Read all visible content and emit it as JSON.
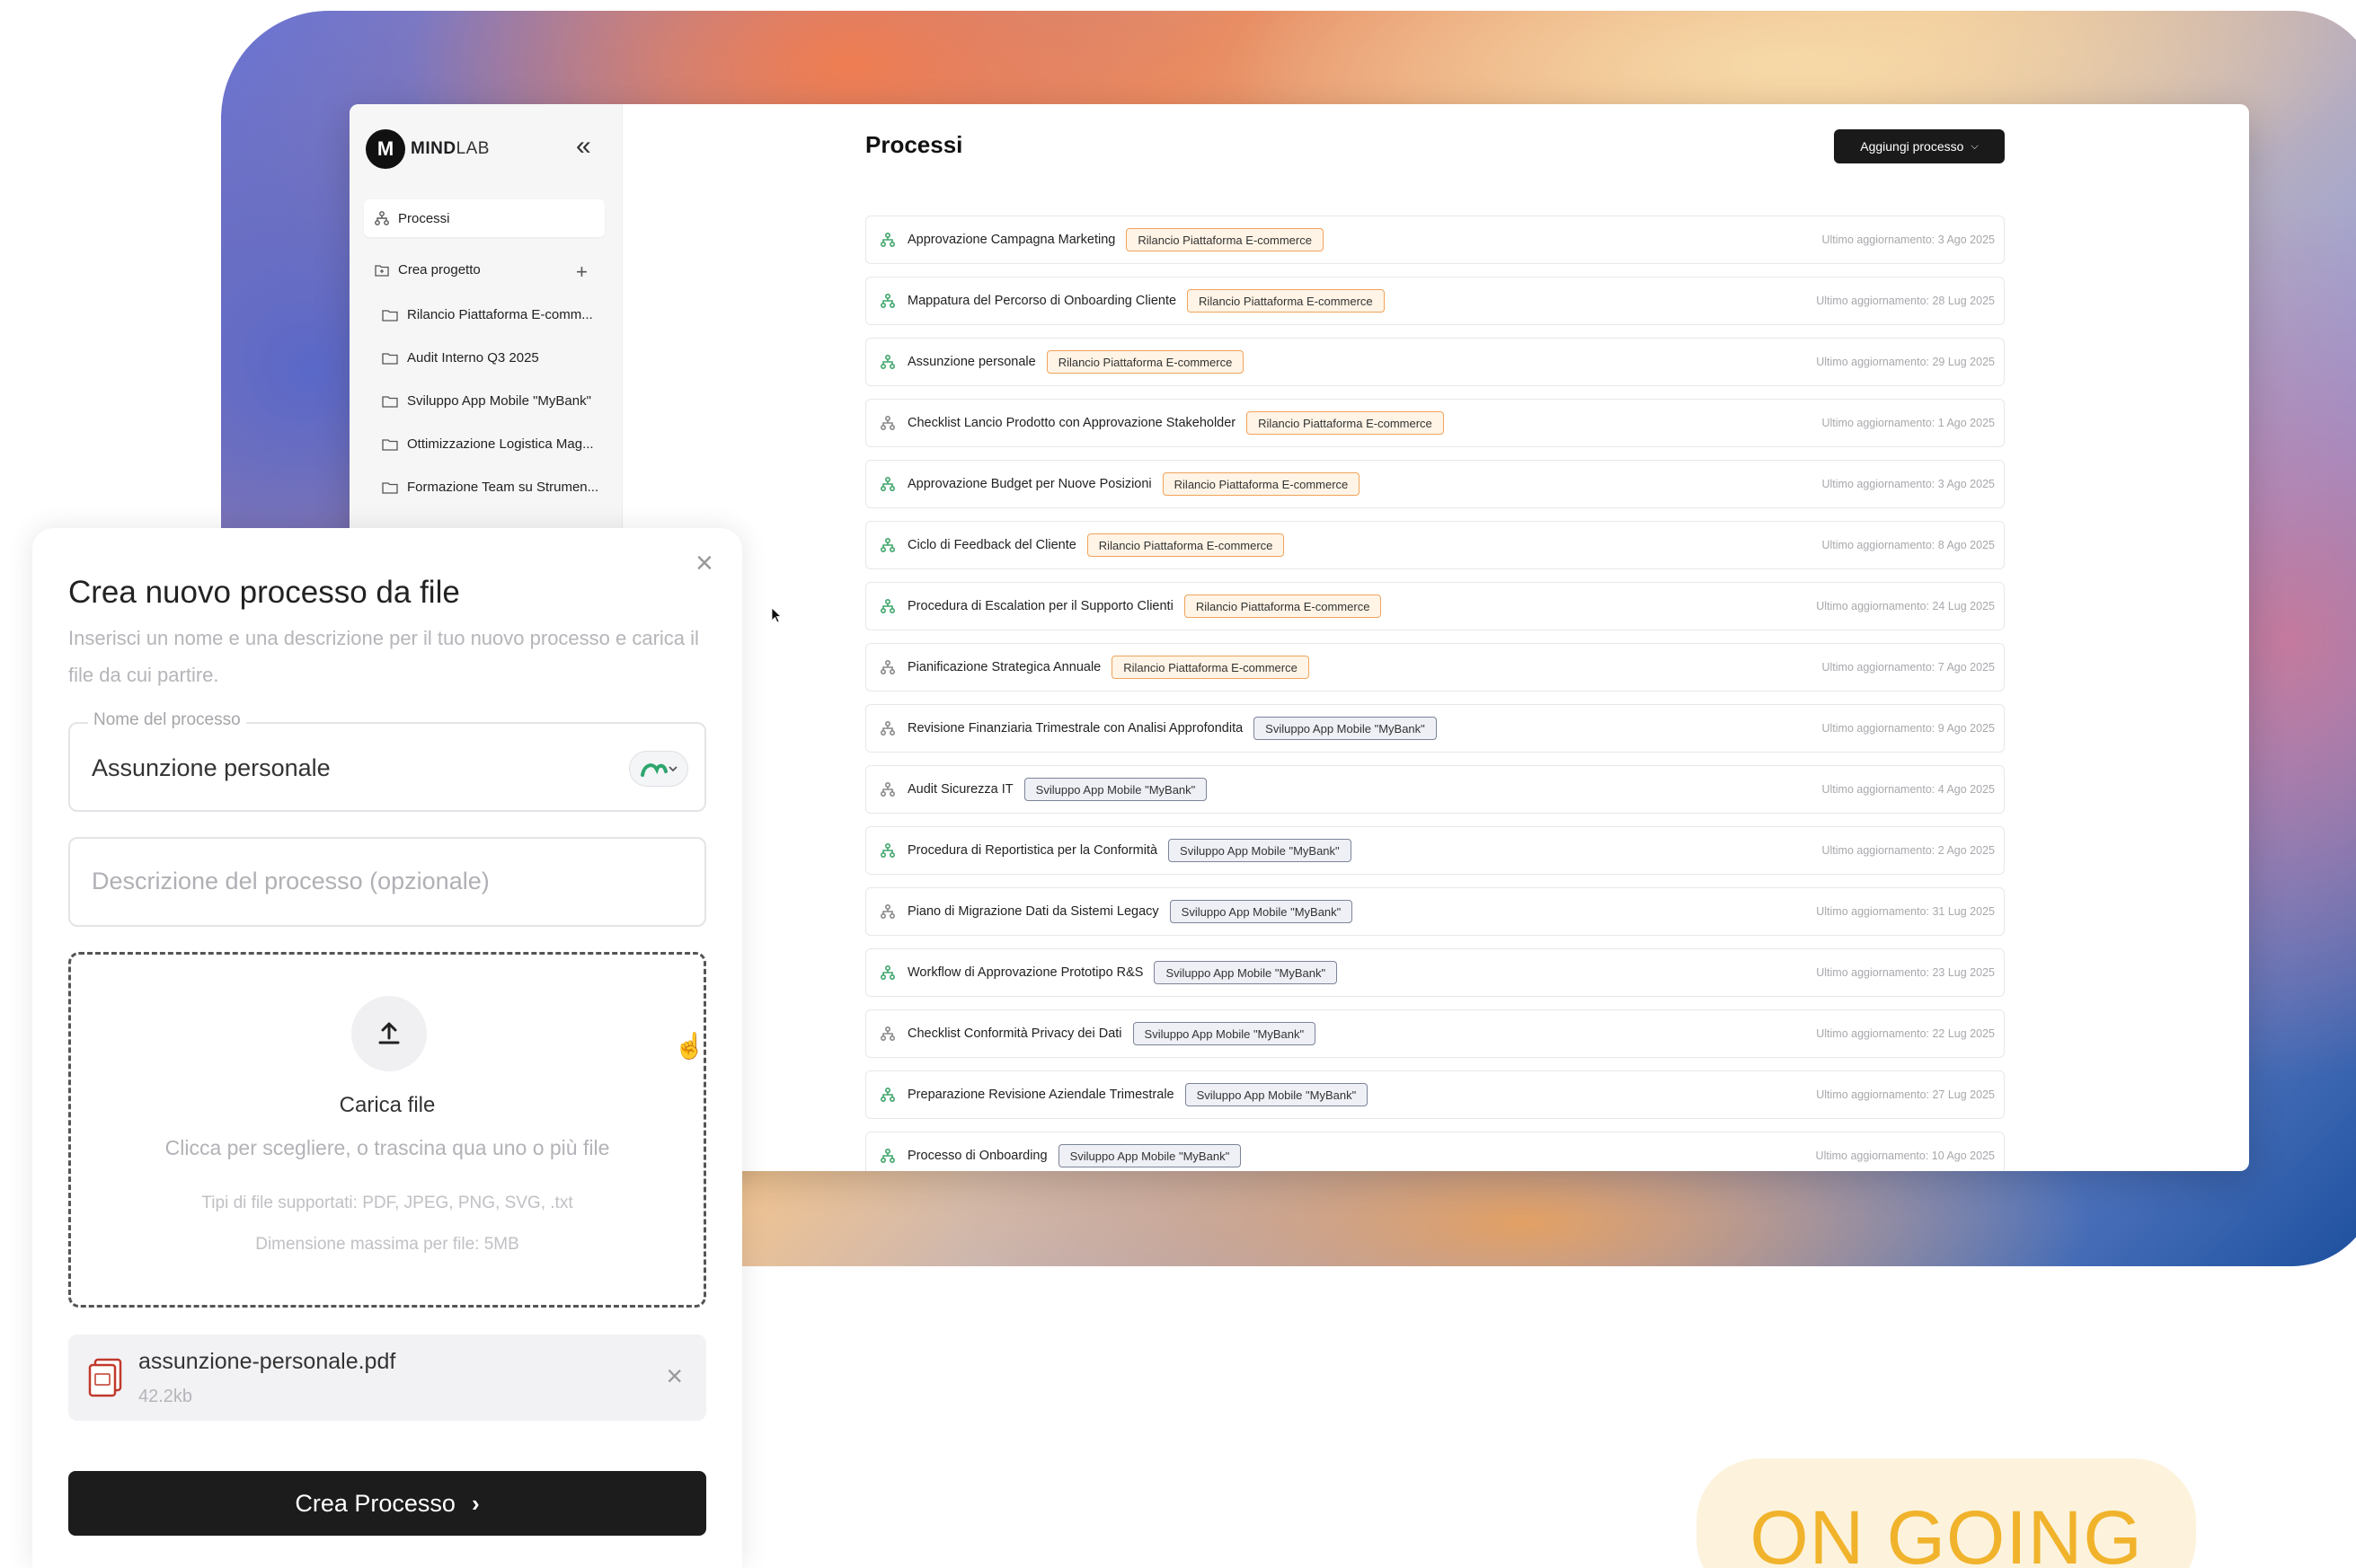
{
  "brand": {
    "logo_letter": "M",
    "name_bold": "MIND",
    "name_light": "LAB"
  },
  "sidebar": {
    "collapse_icon": "«",
    "active_item": "Processi",
    "create_project": "Crea progetto",
    "add_icon": "+",
    "projects": [
      "Rilancio Piattaforma E-comm...",
      "Audit Interno Q3 2025",
      "Sviluppo App Mobile \"MyBank\"",
      "Ottimizzazione Logistica Mag...",
      "Formazione Team su Strumen..."
    ]
  },
  "main": {
    "title": "Processi",
    "add_button": "Aggiungi processo",
    "rows": [
      {
        "name": "Approvazione Campagna Marketing",
        "tag": "Rilancio Piattaforma E-commerce",
        "tag_color": "orange",
        "updated": "Ultimo aggiornamento: 3 Ago 2025",
        "icon_color": "#3fa56b"
      },
      {
        "name": "Mappatura del Percorso di Onboarding Cliente",
        "tag": "Rilancio Piattaforma E-commerce",
        "tag_color": "orange",
        "updated": "Ultimo aggiornamento: 28 Lug 2025",
        "icon_color": "#3fa56b"
      },
      {
        "name": "Assunzione personale",
        "tag": "Rilancio Piattaforma E-commerce",
        "tag_color": "orange",
        "updated": "Ultimo aggiornamento: 29 Lug 2025",
        "icon_color": "#3fa56b"
      },
      {
        "name": "Checklist Lancio Prodotto con Approvazione Stakeholder",
        "tag": "Rilancio Piattaforma E-commerce",
        "tag_color": "orange",
        "updated": "Ultimo aggiornamento: 1 Ago 2025",
        "icon_color": "#888888"
      },
      {
        "name": "Approvazione Budget per Nuove Posizioni",
        "tag": "Rilancio Piattaforma E-commerce",
        "tag_color": "orange",
        "updated": "Ultimo aggiornamento: 3 Ago 2025",
        "icon_color": "#3fa56b"
      },
      {
        "name": "Ciclo di Feedback del Cliente",
        "tag": "Rilancio Piattaforma E-commerce",
        "tag_color": "orange",
        "updated": "Ultimo aggiornamento: 8 Ago 2025",
        "icon_color": "#3fa56b"
      },
      {
        "name": "Procedura di Escalation per il Supporto Clienti",
        "tag": "Rilancio Piattaforma E-commerce",
        "tag_color": "orange",
        "updated": "Ultimo aggiornamento: 24 Lug 2025",
        "icon_color": "#3fa56b"
      },
      {
        "name": "Pianificazione Strategica Annuale",
        "tag": "Rilancio Piattaforma E-commerce",
        "tag_color": "orange",
        "updated": "Ultimo aggiornamento: 7 Ago 2025",
        "icon_color": "#888888"
      },
      {
        "name": "Revisione Finanziaria Trimestrale con Analisi Approfondita",
        "tag": "Sviluppo App Mobile \"MyBank\"",
        "tag_color": "blue",
        "updated": "Ultimo aggiornamento: 9 Ago 2025",
        "icon_color": "#888888"
      },
      {
        "name": "Audit Sicurezza IT",
        "tag": "Sviluppo App Mobile \"MyBank\"",
        "tag_color": "blue",
        "updated": "Ultimo aggiornamento: 4 Ago 2025",
        "icon_color": "#888888"
      },
      {
        "name": "Procedura di Reportistica per la Conformità",
        "tag": "Sviluppo App Mobile \"MyBank\"",
        "tag_color": "blue",
        "updated": "Ultimo aggiornamento: 2 Ago 2025",
        "icon_color": "#3fa56b"
      },
      {
        "name": "Piano di Migrazione Dati da Sistemi Legacy",
        "tag": "Sviluppo App Mobile \"MyBank\"",
        "tag_color": "blue",
        "updated": "Ultimo aggiornamento: 31 Lug 2025",
        "icon_color": "#888888"
      },
      {
        "name": "Workflow di Approvazione Prototipo R&S",
        "tag": "Sviluppo App Mobile \"MyBank\"",
        "tag_color": "blue",
        "updated": "Ultimo aggiornamento: 23 Lug 2025",
        "icon_color": "#3fa56b"
      },
      {
        "name": "Checklist Conformità Privacy dei Dati",
        "tag": "Sviluppo App Mobile \"MyBank\"",
        "tag_color": "blue",
        "updated": "Ultimo aggiornamento: 22 Lug 2025",
        "icon_color": "#888888"
      },
      {
        "name": "Preparazione Revisione Aziendale Trimestrale",
        "tag": "Sviluppo App Mobile \"MyBank\"",
        "tag_color": "blue",
        "updated": "Ultimo aggiornamento: 27 Lug 2025",
        "icon_color": "#3fa56b"
      },
      {
        "name": "Processo di Onboarding",
        "tag": "Sviluppo App Mobile \"MyBank\"",
        "tag_color": "blue",
        "updated": "Ultimo aggiornamento: 10 Ago 2025",
        "icon_color": "#3fa56b"
      }
    ]
  },
  "modal": {
    "title": "Crea nuovo processo da file",
    "subtitle": "Inserisci un nome e una descrizione per il tuo nuovo processo e carica il file da cui partire.",
    "name_label": "Nome del processo",
    "name_value": "Assunzione personale",
    "description_placeholder": "Descrizione del processo (opzionale)",
    "dropzone": {
      "title": "Carica file",
      "subtitle": "Clicca per scegliere, o trascina qua uno o più file",
      "types": "Tipi di file supportati: PDF, JPEG, PNG, SVG, .txt",
      "max": "Dimensione massima per file: 5MB"
    },
    "file": {
      "name": "assunzione-personale.pdf",
      "size": "42.2kb"
    },
    "create_button": "Crea Processo",
    "close_icon": "×",
    "remove_icon": "×"
  },
  "badge": {
    "text": "ON GOING"
  },
  "colors": {
    "accent_orange": "#f0a35a",
    "tag_blue_border": "#7c8498",
    "primary_dark": "#1c1c1c",
    "badge_text": "#f0b32b"
  }
}
